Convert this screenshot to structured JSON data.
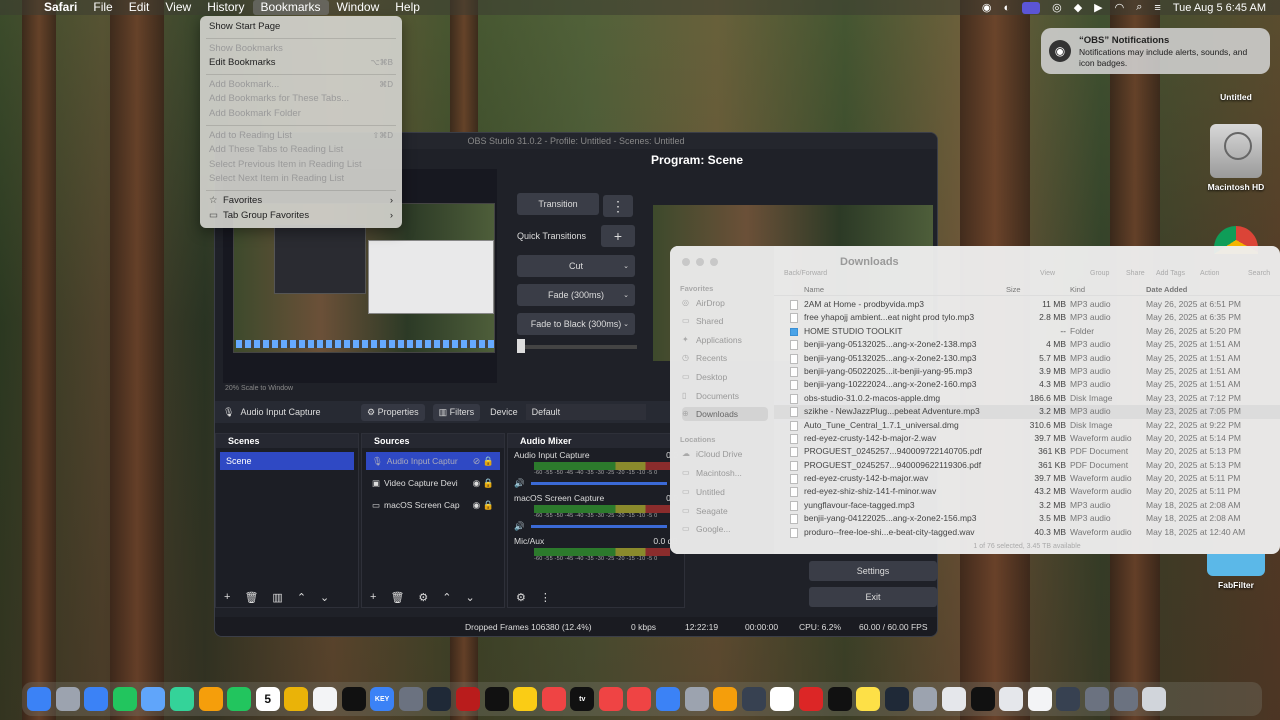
{
  "menubar": {
    "app_name": "Safari",
    "items": [
      "File",
      "Edit",
      "View",
      "History",
      "Bookmarks",
      "Window",
      "Help"
    ],
    "clock": "Tue Aug 5  6:45 AM"
  },
  "bookmarks_menu": {
    "items": [
      {
        "label": "Show Start Page",
        "shortcut": "",
        "enabled": true
      },
      {
        "label": "Show Bookmarks",
        "shortcut": "",
        "enabled": false
      },
      {
        "label": "Edit Bookmarks",
        "shortcut": "⌥⌘B",
        "enabled": true
      },
      {
        "label": "Add Bookmark...",
        "shortcut": "⌘D",
        "enabled": false
      },
      {
        "label": "Add Bookmarks for These Tabs...",
        "shortcut": "",
        "enabled": false
      },
      {
        "label": "Add Bookmark Folder",
        "shortcut": "",
        "enabled": false
      },
      {
        "label": "Add to Reading List",
        "shortcut": "⇧⌘D",
        "enabled": false
      },
      {
        "label": "Add These Tabs to Reading List",
        "shortcut": "",
        "enabled": false
      },
      {
        "label": "Select Previous Item in Reading List",
        "shortcut": "",
        "enabled": false
      },
      {
        "label": "Select Next Item in Reading List",
        "shortcut": "",
        "enabled": false
      },
      {
        "label": "Favorites",
        "shortcut": "",
        "enabled": true
      },
      {
        "label": "Tab Group Favorites",
        "shortcut": "",
        "enabled": true
      }
    ]
  },
  "obs": {
    "title": "OBS Studio 31.0.2 - Profile: Untitled - Scenes: Untitled",
    "program_title": "Program: Scene",
    "zoom_label": "20%   Scale to Window",
    "transition_label": "Transition",
    "quick_transitions_label": "Quick Transitions",
    "transitions": [
      "Cut",
      "Fade (300ms)",
      "Fade to Black (300ms)"
    ],
    "source_name": "Audio Input Capture",
    "properties_label": "Properties",
    "filters_label": "Filters",
    "device_label": "Device",
    "device_value": "Default",
    "scenes_header": "Scenes",
    "scenes": [
      "Scene"
    ],
    "sources_header": "Sources",
    "sources": [
      "Audio Input Captur",
      "Video Capture Devi",
      "macOS Screen Cap"
    ],
    "mixer_header": "Audio Mixer",
    "mixer": [
      {
        "name": "Audio Input Capture",
        "db": "0.0"
      },
      {
        "name": "macOS Screen Capture",
        "db": "0.0"
      },
      {
        "name": "Mic/Aux",
        "db": "0.0 dB"
      }
    ],
    "meter_scale": "-60 -55 -50 -45 -40 -35 -30 -25 -20 -15 -10 -5 0",
    "settings_label": "Settings",
    "exit_label": "Exit",
    "status": {
      "dropped": "Dropped Frames 106380 (12.4%)",
      "kbps": "0 kbps",
      "time1": "12:22:19",
      "time2": "00:00:00",
      "cpu": "CPU: 6.2%",
      "fps": "60.00 / 60.00 FPS"
    }
  },
  "finder": {
    "title": "Downloads",
    "toolbar": [
      "Back/Forward",
      "View",
      "Group",
      "Share",
      "Add Tags",
      "Action",
      "Search"
    ],
    "favorites_header": "Favorites",
    "favorites": [
      "AirDrop",
      "Shared",
      "Applications",
      "Recents",
      "Desktop",
      "Documents",
      "Downloads"
    ],
    "locations_header": "Locations",
    "locations": [
      "iCloud Drive",
      "Macintosh...",
      "Untitled",
      "Seagate",
      "Google..."
    ],
    "columns": {
      "name": "Name",
      "size": "Size",
      "kind": "Kind",
      "date": "Date Added"
    },
    "files": [
      {
        "name": "2AM at Home - prodbyvida.mp3",
        "size": "11 MB",
        "kind": "MP3 audio",
        "date": "May 26, 2025 at 6:51 PM",
        "folder": false
      },
      {
        "name": "free yhapojj  ambient...eat night prod tylo.mp3",
        "size": "2.8 MB",
        "kind": "MP3 audio",
        "date": "May 26, 2025 at 6:35 PM",
        "folder": false
      },
      {
        "name": "HOME STUDIO TOOLKIT",
        "size": "--",
        "kind": "Folder",
        "date": "May 26, 2025 at 5:20 PM",
        "folder": true
      },
      {
        "name": "benjii-yang-05132025...ang-x-2one2-138.mp3",
        "size": "4 MB",
        "kind": "MP3 audio",
        "date": "May 25, 2025 at 1:51 AM",
        "folder": false
      },
      {
        "name": "benjii-yang-05132025...ang-x-2one2-130.mp3",
        "size": "5.7 MB",
        "kind": "MP3 audio",
        "date": "May 25, 2025 at 1:51 AM",
        "folder": false
      },
      {
        "name": "benjii-yang-05022025...it-benjii-yang-95.mp3",
        "size": "3.9 MB",
        "kind": "MP3 audio",
        "date": "May 25, 2025 at 1:51 AM",
        "folder": false
      },
      {
        "name": "benjii-yang-10222024...ang-x-2one2-160.mp3",
        "size": "4.3 MB",
        "kind": "MP3 audio",
        "date": "May 25, 2025 at 1:51 AM",
        "folder": false
      },
      {
        "name": "obs-studio-31.0.2-macos-apple.dmg",
        "size": "186.6 MB",
        "kind": "Disk Image",
        "date": "May 23, 2025 at 7:12 PM",
        "folder": false
      },
      {
        "name": "szikhe - NewJazzPlug...pebeat Adventure.mp3",
        "size": "3.2 MB",
        "kind": "MP3 audio",
        "date": "May 23, 2025 at 7:05 PM",
        "folder": false
      },
      {
        "name": "Auto_Tune_Central_1.7.1_universal.dmg",
        "size": "310.6 MB",
        "kind": "Disk Image",
        "date": "May 22, 2025 at 9:22 PM",
        "folder": false
      },
      {
        "name": "red-eyez-crusty-142-b-major-2.wav",
        "size": "39.7 MB",
        "kind": "Waveform audio",
        "date": "May 20, 2025 at 5:14 PM",
        "folder": false
      },
      {
        "name": "PROGUEST_0245257...940009722140705.pdf",
        "size": "361 KB",
        "kind": "PDF Document",
        "date": "May 20, 2025 at 5:13 PM",
        "folder": false
      },
      {
        "name": "PROGUEST_0245257...940009622119306.pdf",
        "size": "361 KB",
        "kind": "PDF Document",
        "date": "May 20, 2025 at 5:13 PM",
        "folder": false
      },
      {
        "name": "red-eyez-crusty-142-b-major.wav",
        "size": "39.7 MB",
        "kind": "Waveform audio",
        "date": "May 20, 2025 at 5:11 PM",
        "folder": false
      },
      {
        "name": "red-eyez-shiz-shiz-141-f-minor.wav",
        "size": "43.2 MB",
        "kind": "Waveform audio",
        "date": "May 20, 2025 at 5:11 PM",
        "folder": false
      },
      {
        "name": "yungflavour-face-tagged.mp3",
        "size": "3.2 MB",
        "kind": "MP3 audio",
        "date": "May 18, 2025 at 2:08 AM",
        "folder": false
      },
      {
        "name": "benjii-yang-04122025...ang-x-2one2-156.mp3",
        "size": "3.5 MB",
        "kind": "MP3 audio",
        "date": "May 18, 2025 at 2:08 AM",
        "folder": false
      },
      {
        "name": "produro--free-loe-shi...e-beat-city-tagged.wav",
        "size": "40.3 MB",
        "kind": "Waveform audio",
        "date": "May 18, 2025 at 12:40 AM",
        "folder": false
      }
    ],
    "footer": "1 of 76 selected, 3.45 TB available"
  },
  "notification": {
    "title": "“OBS” Notifications",
    "body": "Notifications may include alerts, sounds, and icon badges."
  },
  "desktop": {
    "icons": [
      "Untitled",
      "Macintosh HD",
      "FabFilter"
    ]
  },
  "dock": {
    "apps": [
      "Finder",
      "Launchpad",
      "Safari",
      "Messages",
      "Mail",
      "Maps",
      "Photos",
      "FaceTime",
      "Calendar",
      "Notes",
      "Reminders",
      "Freeform",
      "Keynote",
      "Disk",
      "Logic",
      "Trilian",
      "KT",
      "Stickies",
      "Music",
      "TV",
      "Apple Music",
      "News",
      "App Store",
      "System Settings",
      "Audacity",
      "Mixer",
      "Chrome",
      "Pages",
      "Ableton",
      "Light",
      "OBS",
      "Preview",
      "Folder",
      "Terminal",
      "Files",
      "Docs",
      "Calculator",
      "Files2",
      "Files3",
      "Trash"
    ],
    "key_label": "KEY",
    "cal_day": "5",
    "tv_label": "tv"
  }
}
